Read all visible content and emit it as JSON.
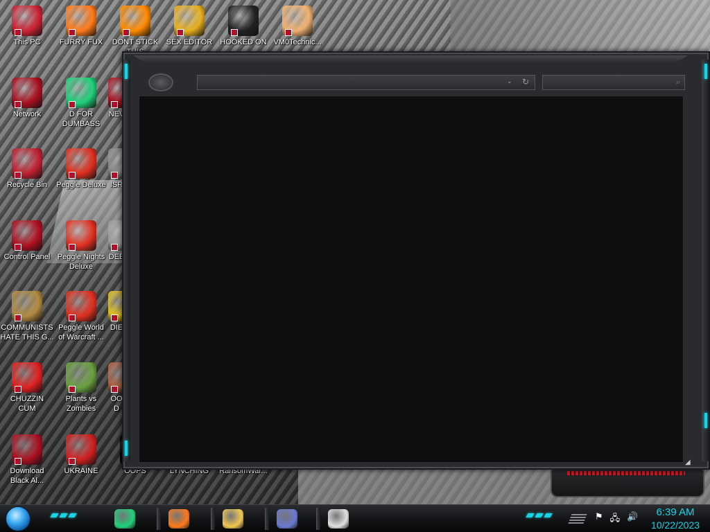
{
  "desktop": {
    "icons": [
      {
        "label": "This PC",
        "icon": "monitor-icon",
        "color": "#cc2233"
      },
      {
        "label": "FURRY FUX",
        "icon": "firefox-icon",
        "color": "#ff7a1a"
      },
      {
        "label": "DONT STICK\nTHIS",
        "icon": "vlc-cone-icon",
        "color": "#ff8a00"
      },
      {
        "label": "SEX EDITOR",
        "icon": "hxd-icon",
        "color": "#e8b020"
      },
      {
        "label": "HOOKED ON",
        "icon": "maze-icon",
        "color": "#222222"
      },
      {
        "label": "VM0Technic...",
        "icon": "doctor-icon",
        "color": "#f0b070"
      },
      {
        "label": "Network",
        "icon": "network-orb-icon",
        "color": "#aa1020"
      },
      {
        "label": "D FOR\nDUMBASS",
        "icon": "notes-icon",
        "color": "#1fd07a"
      },
      {
        "label": "NEV",
        "icon": "app-icon",
        "color": "#aa1020"
      },
      {
        "label": "Recycle Bin",
        "icon": "recycle-bin-icon",
        "color": "#c02030"
      },
      {
        "label": "Peggle Deluxe",
        "icon": "peggle-icon",
        "color": "#e03020"
      },
      {
        "label": "ISR",
        "icon": "app-icon",
        "color": "#888888"
      },
      {
        "label": "Control Panel",
        "icon": "control-panel-icon",
        "color": "#b01020"
      },
      {
        "label": "Peggle Nights\nDeluxe",
        "icon": "peggle-nights-icon",
        "color": "#e03020"
      },
      {
        "label": "DEE",
        "icon": "app-icon",
        "color": "#999999"
      },
      {
        "label": "COMMUNISTS\nHATE THIS G...",
        "icon": "money-bag-icon",
        "color": "#b08a40"
      },
      {
        "label": "Peggle World\nof Warcraft ...",
        "icon": "peggle-wow-icon",
        "color": "#e03020"
      },
      {
        "label": "DIE",
        "icon": "app-icon",
        "color": "#e0c020"
      },
      {
        "label": "CHUZZIN\nCUM",
        "icon": "chuzzle-icon",
        "color": "#e02020"
      },
      {
        "label": "Plants vs\nZombies",
        "icon": "pvz-icon",
        "color": "#6aa040"
      },
      {
        "label": "OO\nD",
        "icon": "app-icon",
        "color": "#aa6040"
      },
      {
        "label": "Download\nBlack Al...",
        "icon": "network-orb-icon",
        "color": "#aa1020"
      },
      {
        "label": "UKRAINE",
        "icon": "radiation-icon",
        "color": "#d02020"
      },
      {
        "label": "OOPS",
        "icon": "app-icon",
        "color": "#000000"
      },
      {
        "label": "LYNCHING",
        "icon": "app-icon",
        "color": "#000000"
      },
      {
        "label": "RansomWar...",
        "icon": "app-icon",
        "color": "#000000"
      }
    ]
  },
  "window": {
    "address_value": "",
    "address_placeholder": "",
    "search_placeholder": "",
    "colors": {
      "accent": "#19d3e6",
      "alert": "#d01525",
      "content": "#0f0f10"
    }
  },
  "taskbar": {
    "pinned": [
      {
        "name": "notes-app",
        "icon": "notes-icon",
        "color": "#1fd07a"
      },
      {
        "name": "firefox",
        "icon": "firefox-icon",
        "color": "#ff7a1a"
      },
      {
        "name": "file-explorer",
        "icon": "folder-icon",
        "color": "#f0c850"
      },
      {
        "name": "control-panel",
        "icon": "card-icon",
        "color": "#6a7ad0"
      },
      {
        "name": "paint",
        "icon": "palette-icon",
        "color": "#e0e0e0"
      }
    ],
    "tray": {
      "flag": "flag-icon",
      "network": "network-icon",
      "volume": "volume-icon"
    },
    "clock": {
      "time": "6:39 AM",
      "date": "10/22/2023"
    }
  }
}
